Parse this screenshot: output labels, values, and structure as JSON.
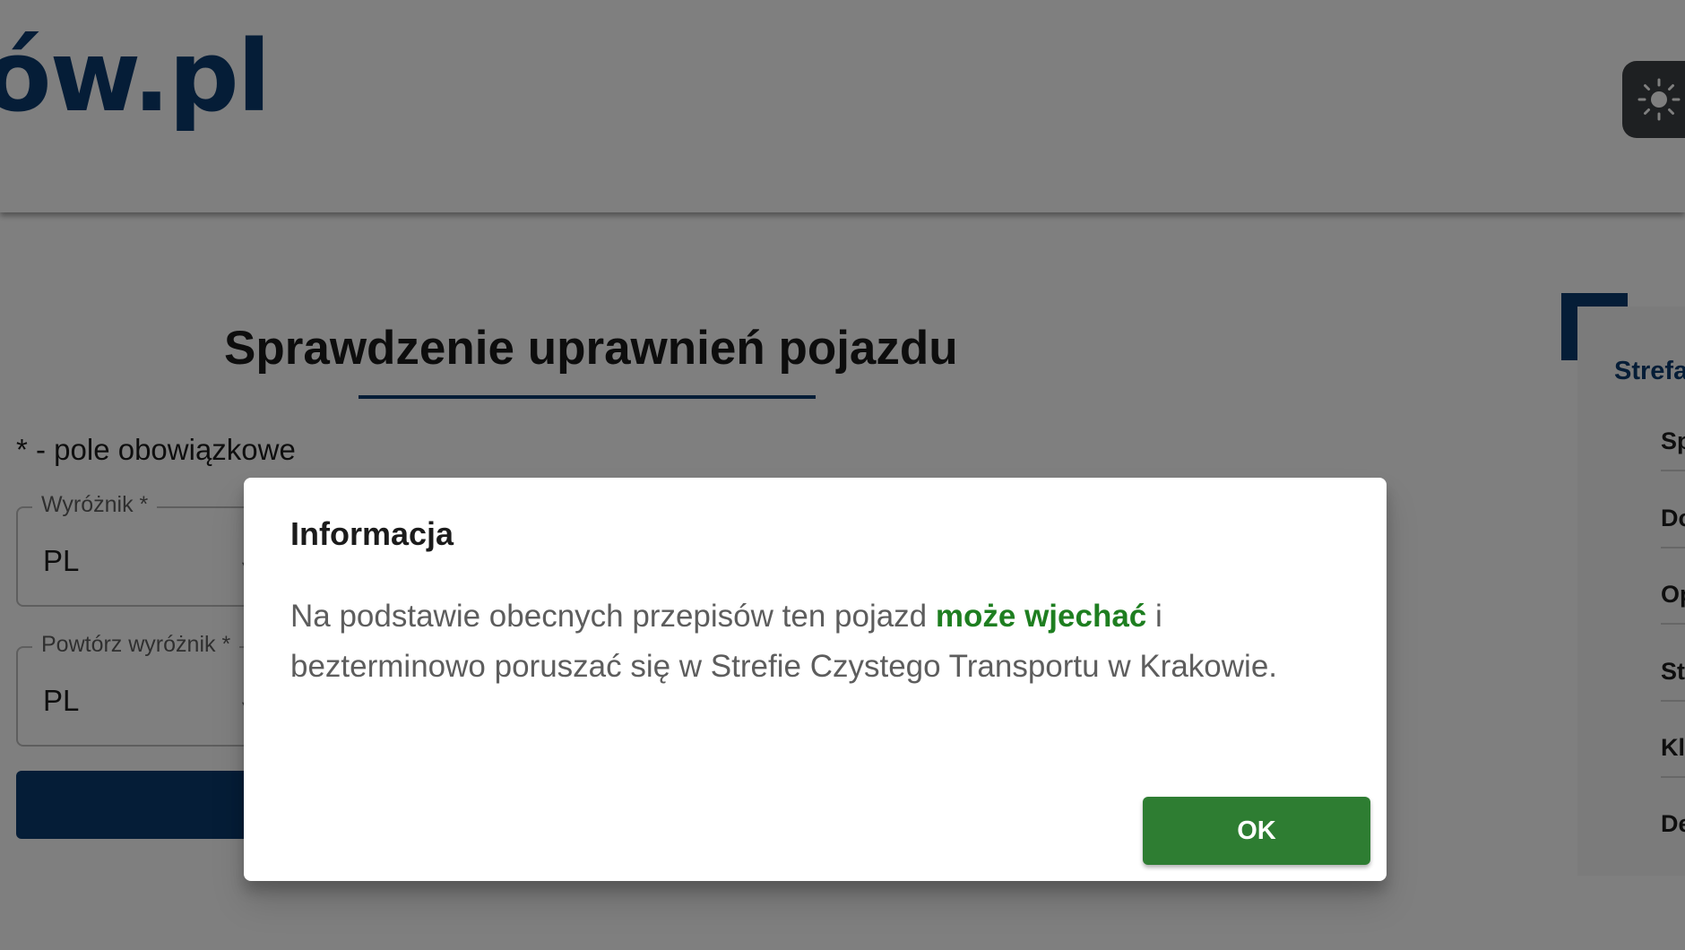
{
  "header": {
    "logo_text": "ów.pl",
    "theme_toggle_icon": "sun-icon"
  },
  "main": {
    "page_title": "Sprawdzenie uprawnień pojazdu",
    "required_note": "* - pole obowiązkowe",
    "fields": [
      {
        "label": "Wyróżnik *",
        "value": "PL"
      },
      {
        "label": "Powtórz wyróżnik *",
        "value": "PL"
      }
    ]
  },
  "side_panel": {
    "title": "Strefa",
    "items": [
      "Sp",
      "Do",
      "Op",
      "St",
      "Kl",
      "De"
    ]
  },
  "dialog": {
    "title": "Informacja",
    "text_before": "Na podstawie obecnych przepisów ten pojazd ",
    "text_highlight": "może wjechać",
    "text_after": " i bezterminowo poruszać się w Strefie Czystego Transportu w Krakowie.",
    "ok_label": "OK"
  },
  "colors": {
    "brand_blue": "#0b3a6f",
    "success_green": "#2e7d32",
    "highlight_green": "#1e7e20"
  }
}
